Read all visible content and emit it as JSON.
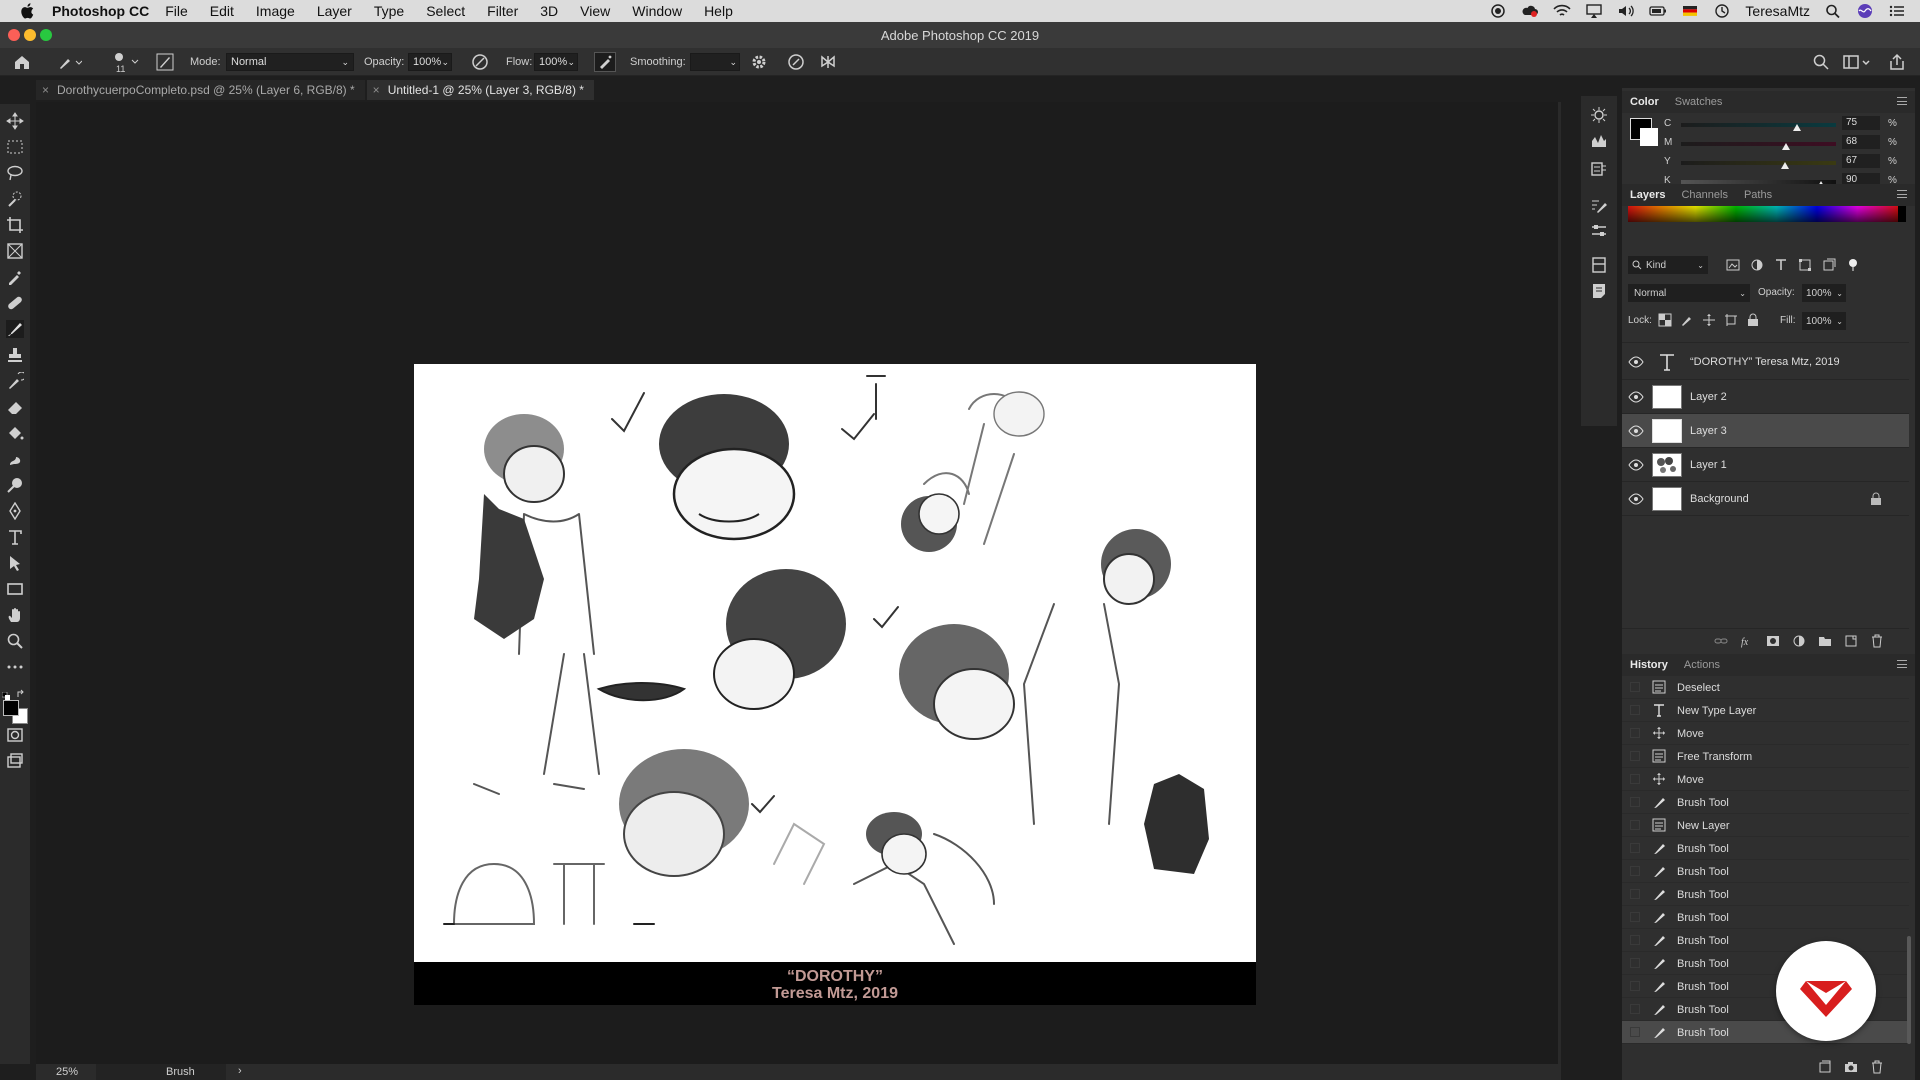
{
  "menubar": {
    "app_name": "Photoshop CC",
    "items": [
      "File",
      "Edit",
      "Image",
      "Layer",
      "Type",
      "Select",
      "Filter",
      "3D",
      "View",
      "Window",
      "Help"
    ],
    "username": "TeresaMtz"
  },
  "window": {
    "title": "Adobe Photoshop CC 2019"
  },
  "options": {
    "brush_size": "11",
    "mode_label": "Mode:",
    "mode_value": "Normal",
    "opacity_label": "Opacity:",
    "opacity_value": "100%",
    "flow_label": "Flow:",
    "flow_value": "100%",
    "smoothing_label": "Smoothing:",
    "smoothing_value": ""
  },
  "tabs": [
    {
      "label": "DorothycuerpoCompleto.psd @ 25% (Layer 6, RGB/8) *",
      "active": false
    },
    {
      "label": "Untitled-1 @ 25% (Layer 3, RGB/8) *",
      "active": true
    }
  ],
  "canvas": {
    "caption_line1": "“DOROTHY”",
    "caption_line2": "Teresa Mtz, 2019"
  },
  "color_panel": {
    "tabs": [
      "Color",
      "Swatches"
    ],
    "channels": [
      {
        "label": "C",
        "value": "75",
        "unit": "%",
        "level": 0.75
      },
      {
        "label": "M",
        "value": "68",
        "unit": "%",
        "level": 0.68
      },
      {
        "label": "Y",
        "value": "67",
        "unit": "%",
        "level": 0.67
      },
      {
        "label": "K",
        "value": "90",
        "unit": "%",
        "level": 0.9
      }
    ]
  },
  "layers_panel": {
    "tabs": [
      "Layers",
      "Channels",
      "Paths"
    ],
    "filter_label": "Kind",
    "blend_mode": "Normal",
    "opacity_label": "Opacity:",
    "opacity_value": "100%",
    "lock_label": "Lock:",
    "fill_label": "Fill:",
    "fill_value": "100%",
    "layers": [
      {
        "name": "“DOROTHY” Teresa Mtz, 2019",
        "type": "text"
      },
      {
        "name": "Layer 2",
        "type": "transparent"
      },
      {
        "name": "Layer 3",
        "type": "transparent",
        "selected": true
      },
      {
        "name": "Layer 1",
        "type": "sketch"
      },
      {
        "name": "Background",
        "type": "white",
        "locked": true
      }
    ]
  },
  "history_panel": {
    "tabs": [
      "History",
      "Actions"
    ],
    "steps": [
      {
        "name": "Deselect",
        "icon": "doc-icon"
      },
      {
        "name": "New Type Layer",
        "icon": "type-icon"
      },
      {
        "name": "Move",
        "icon": "move-icon"
      },
      {
        "name": "Free Transform",
        "icon": "doc-icon"
      },
      {
        "name": "Move",
        "icon": "move-icon"
      },
      {
        "name": "Brush Tool",
        "icon": "brush-icon"
      },
      {
        "name": "New Layer",
        "icon": "doc-icon"
      },
      {
        "name": "Brush Tool",
        "icon": "brush-icon"
      },
      {
        "name": "Brush Tool",
        "icon": "brush-icon"
      },
      {
        "name": "Brush Tool",
        "icon": "brush-icon"
      },
      {
        "name": "Brush Tool",
        "icon": "brush-icon"
      },
      {
        "name": "Brush Tool",
        "icon": "brush-icon"
      },
      {
        "name": "Brush Tool",
        "icon": "brush-icon"
      },
      {
        "name": "Brush Tool",
        "icon": "brush-icon"
      },
      {
        "name": "Brush Tool",
        "icon": "brush-icon"
      },
      {
        "name": "Brush Tool",
        "icon": "brush-icon"
      }
    ]
  },
  "statusbar": {
    "zoom": "25%",
    "tool": "Brush"
  },
  "colors": {
    "accent_red": "#d81e1e",
    "caption_color": "#c29a95"
  }
}
